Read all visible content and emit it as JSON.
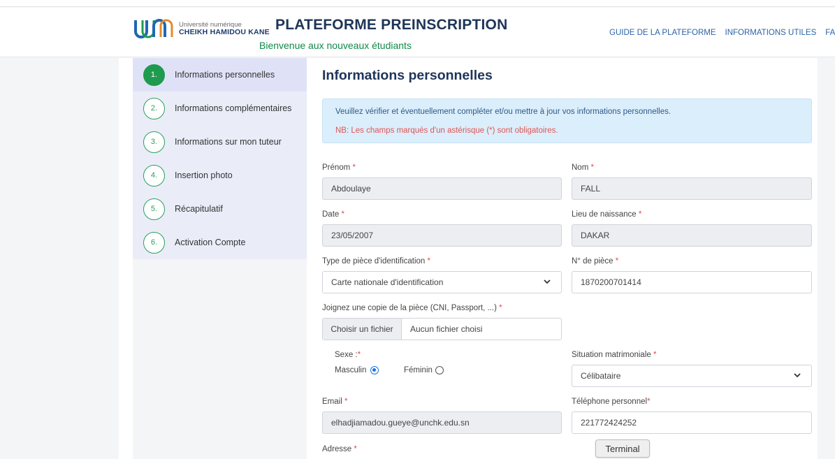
{
  "header": {
    "logo_small": "Université numérique",
    "logo_big": "CHEIKH HAMIDOU KANE",
    "title": "PLATEFORME PREINSCRIPTION",
    "subtitle": "Bienvenue aux nouveaux étudiants",
    "nav": [
      "GUIDE DE LA PLATEFORME",
      "INFORMATIONS UTILES",
      "FAQ"
    ]
  },
  "steps": [
    {
      "num": "1.",
      "label": "Informations personnelles",
      "active": true
    },
    {
      "num": "2.",
      "label": "Informations complémentaires",
      "active": false
    },
    {
      "num": "3.",
      "label": "Informations sur mon tuteur",
      "active": false
    },
    {
      "num": "4.",
      "label": "Insertion photo",
      "active": false
    },
    {
      "num": "5.",
      "label": "Récapitulatif",
      "active": false
    },
    {
      "num": "6.",
      "label": "Activation Compte",
      "active": false
    }
  ],
  "main": {
    "title": "Informations personnelles",
    "alert_info": "Veuillez vérifier et éventuellement compléter et/ou mettre à jour vos informations personnelles.",
    "alert_note": "NB: Les champs marqués d'un astérisque (*) sont obligatoires."
  },
  "form": {
    "prenom_label": "Prénom",
    "prenom_value": "Abdoulaye",
    "nom_label": "Nom",
    "nom_value": "FALL",
    "date_label": "Date",
    "date_value": "23/05/2007",
    "lieu_label": "Lieu de naissance",
    "lieu_value": "DAKAR",
    "type_piece_label": "Type de pièce d'identification",
    "type_piece_value": "Carte nationale d'identification",
    "num_piece_label": "N° de pièce",
    "num_piece_value": "1870200701414",
    "copie_label": "Joignez une copie de la pièce (CNI, Passport, ...)",
    "file_button": "Choisir un fichier",
    "file_status": "Aucun fichier choisi",
    "sexe_label": "Sexe :",
    "masculin": "Masculin",
    "feminin": "Féminin",
    "situation_label": "Situation matrimoniale",
    "situation_value": "Célibataire",
    "email_label": "Email",
    "email_value": "elhadjiamadou.gueye@unchk.edu.sn",
    "tel_label": "Téléphone personnel",
    "tel_value": "221772424252",
    "adresse_label": "Adresse",
    "required_mark": "*"
  },
  "terminal_label": "Terminal",
  "colors": {
    "brand_navy": "#1f3558",
    "brand_green": "#0f8a4a",
    "accent_blue": "#2d63a6",
    "required_red": "#e24b4b"
  }
}
